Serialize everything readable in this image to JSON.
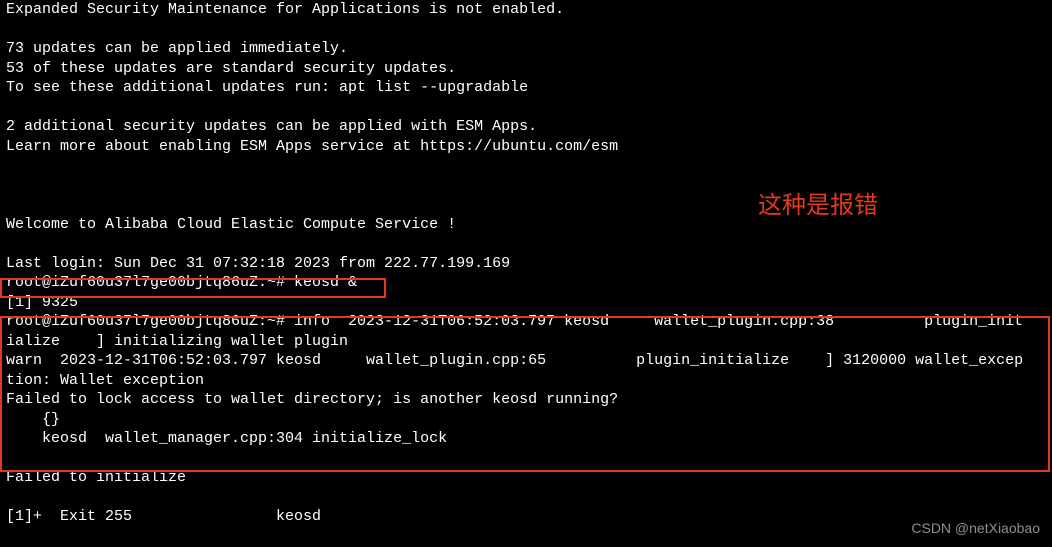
{
  "annotation": "这种是报错",
  "watermark": "CSDN @netXiaobao",
  "lines": {
    "l0": "Expanded Security Maintenance for Applications is not enabled.",
    "l1": " ",
    "l2": "73 updates can be applied immediately.",
    "l3": "53 of these updates are standard security updates.",
    "l4": "To see these additional updates run: apt list --upgradable",
    "l5": " ",
    "l6": "2 additional security updates can be applied with ESM Apps.",
    "l7": "Learn more about enabling ESM Apps service at https://ubuntu.com/esm",
    "l8": " ",
    "l9": " ",
    "l10": " ",
    "l11": "Welcome to Alibaba Cloud Elastic Compute Service !",
    "l12": " ",
    "l13": "Last login: Sun Dec 31 07:32:18 2023 from 222.77.199.169",
    "l14": "root@iZuf60u37l7ge00bjtq86uZ:~# keosd &",
    "l15": "[1] 9325",
    "l16": "root@iZuf60u37l7ge00bjtq86uZ:~# info  2023-12-31T06:52:03.797 keosd     wallet_plugin.cpp:38          plugin_init",
    "l17": "ialize    ] initializing wallet plugin",
    "l18": "warn  2023-12-31T06:52:03.797 keosd     wallet_plugin.cpp:65          plugin_initialize    ] 3120000 wallet_excep",
    "l19": "tion: Wallet exception",
    "l20": "Failed to lock access to wallet directory; is another keosd running?",
    "l21": "    {}",
    "l22": "    keosd  wallet_manager.cpp:304 initialize_lock",
    "l23": " ",
    "l24": "Failed to initialize",
    "l25": " ",
    "l26": "[1]+  Exit 255                keosd"
  }
}
